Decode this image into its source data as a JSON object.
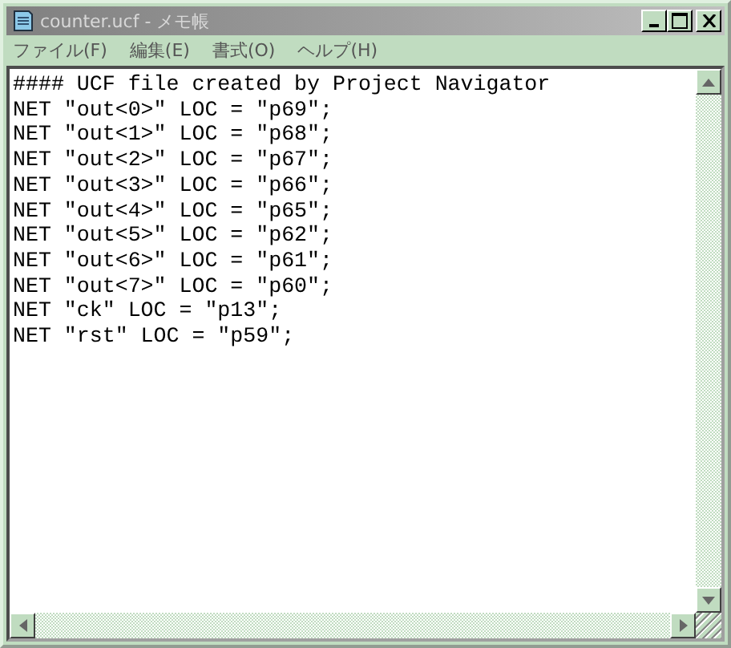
{
  "window": {
    "title": "counter.ucf - メモ帳"
  },
  "menu": [
    {
      "label": "ファイル(F)"
    },
    {
      "label": "編集(E)"
    },
    {
      "label": "書式(O)"
    },
    {
      "label": "ヘルプ(H)"
    }
  ],
  "editor": {
    "lines": [
      "#### UCF file created by Project Navigator",
      "NET \"out<0>\" LOC = \"p69\";",
      "NET \"out<1>\" LOC = \"p68\";",
      "NET \"out<2>\" LOC = \"p67\";",
      "NET \"out<3>\" LOC = \"p66\";",
      "NET \"out<4>\" LOC = \"p65\";",
      "NET \"out<5>\" LOC = \"p62\";",
      "NET \"out<6>\" LOC = \"p61\";",
      "NET \"out<7>\" LOC = \"p60\";",
      "NET \"ck\" LOC = \"p13\";",
      "NET \"rst\" LOC = \"p59\";"
    ]
  }
}
